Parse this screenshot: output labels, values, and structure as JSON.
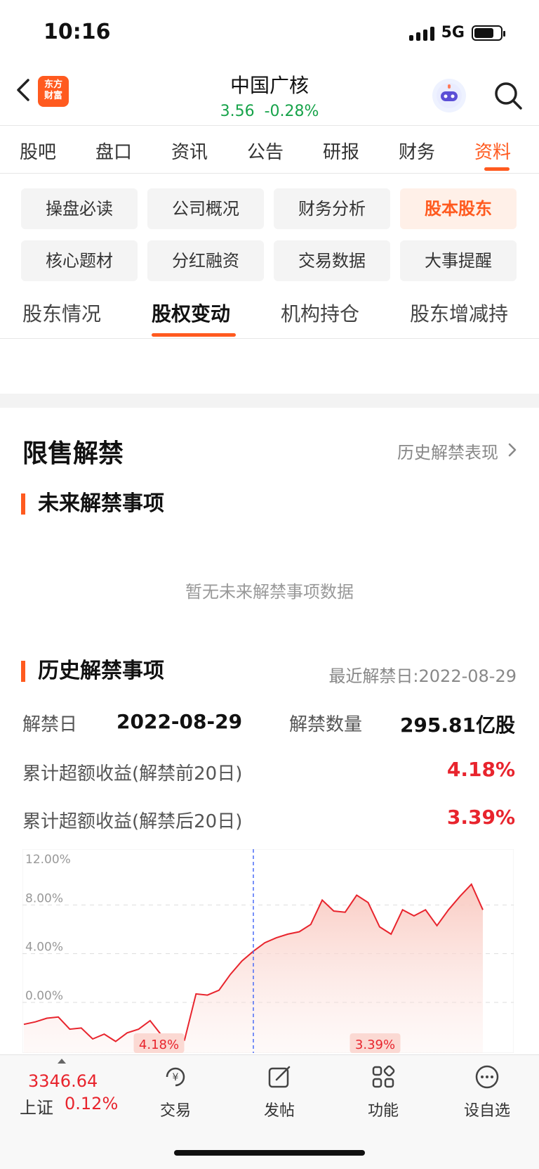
{
  "status": {
    "time": "10:16",
    "network": "5G"
  },
  "header": {
    "logo_line1": "东方",
    "logo_line2": "财富",
    "title": "中国广核",
    "price": "3.56",
    "change": "-0.28%"
  },
  "tabs": [
    "股吧",
    "盘口",
    "资讯",
    "公告",
    "研报",
    "财务",
    "资料"
  ],
  "subtabs": [
    "操盘必读",
    "公司概况",
    "财务分析",
    "股本股东",
    "核心题材",
    "分红融资",
    "交易数据",
    "大事提醒"
  ],
  "section_tabs": [
    "股东情况",
    "股权变动",
    "机构持仓",
    "股东增减持"
  ],
  "content": {
    "heading": "限售解禁",
    "history_link": "历史解禁表现",
    "future_title": "未来解禁事项",
    "empty_text": "暂无未来解禁事项数据",
    "history_title": "历史解禁事项",
    "recent_label": "最近解禁日:2022-08-29",
    "unlock_date_label": "解禁日",
    "unlock_date": "2022-08-29",
    "unlock_qty_label": "解禁数量",
    "unlock_qty": "295.81亿股",
    "before_label": "累计超额收益(解禁前20日)",
    "before_value": "4.18%",
    "after_label": "累计超额收益(解禁后20日)",
    "after_value": "3.39%"
  },
  "chart_data": {
    "type": "area",
    "y_ticks": [
      "12.00%",
      "8.00%",
      "4.00%",
      "0.00%"
    ],
    "ylim": [
      -4,
      12
    ],
    "unlock_index": 20,
    "before_label": "4.18%",
    "after_label": "3.39%",
    "values": [
      -1.8,
      -1.6,
      -1.3,
      -1.2,
      -2.2,
      -2.1,
      -3.0,
      -2.6,
      -3.2,
      -2.5,
      -2.2,
      -1.5,
      -2.7,
      -3.0,
      -3.1,
      0.7,
      0.6,
      1.0,
      2.3,
      3.4,
      4.2,
      4.9,
      5.3,
      5.6,
      5.8,
      6.4,
      8.4,
      7.5,
      7.4,
      8.8,
      8.2,
      6.2,
      5.6,
      7.6,
      7.1,
      7.6,
      6.3,
      7.6,
      8.7,
      9.7,
      7.6
    ],
    "colors": {
      "line": "#e8242d",
      "fill_top": "#f9c8bf",
      "unlock_line": "#4a6cf7"
    }
  },
  "bottom": {
    "index_value": "3346.64",
    "index_name": "上证",
    "index_pct": "0.12%",
    "nav": [
      "交易",
      "发帖",
      "功能",
      "设自选"
    ]
  }
}
